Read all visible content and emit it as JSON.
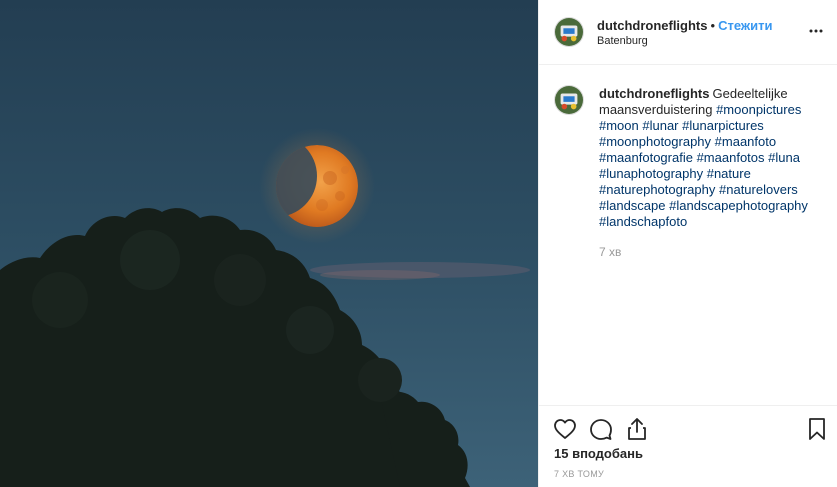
{
  "post": {
    "username": "dutchdroneflights",
    "separator": "•",
    "follow_label": "Стежити",
    "location": "Batenburg"
  },
  "caption": {
    "username": "dutchdroneflights",
    "text_plain": "Gedeeltelijke maansverduistering",
    "hashtags": [
      "#moonpictures",
      "#moon",
      "#lunar",
      "#lunarpictures",
      "#moonphotography",
      "#maanfoto",
      "#maanfotografie",
      "#maanfotos",
      "#luna",
      "#lunaphotography",
      "#nature",
      "#naturephotography",
      "#naturelovers",
      "#landscape",
      "#landscapephotography",
      "#landschapfoto"
    ],
    "time": "7 хв"
  },
  "footer": {
    "likes": "15 вподобань",
    "timestamp": "7 хв тому"
  },
  "icons": {
    "more": "more-options-icon",
    "like": "heart-icon",
    "comment": "comment-icon",
    "share": "share-icon",
    "save": "bookmark-icon"
  },
  "colors": {
    "follow": "#3897f0",
    "hashtag": "#003569",
    "muted": "#999999",
    "sky": "#2b4a5e",
    "moon": "#e8892a"
  }
}
